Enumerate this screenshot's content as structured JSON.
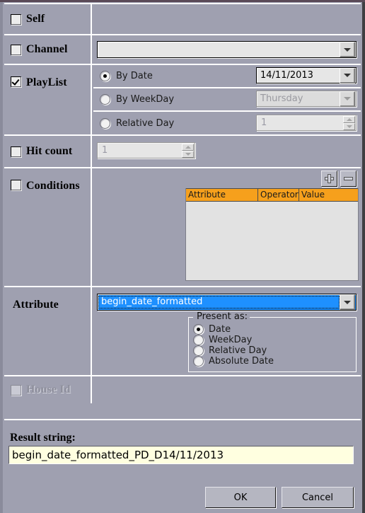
{
  "window": {
    "bg_color": "#9fa0b0",
    "accent_orange": "#f6a01c",
    "select_blue": "#1e90ff",
    "result_bg": "#ffffe0"
  },
  "rows": {
    "self": {
      "label": "Self",
      "checked": false,
      "enabled": true
    },
    "channel": {
      "label": "Channel",
      "checked": false,
      "enabled": true,
      "combo_value": "",
      "combo_placeholder": ""
    },
    "playlist": {
      "label": "PlayList",
      "checked": true,
      "enabled": true,
      "options": [
        {
          "label": "By Date",
          "selected": true
        },
        {
          "label": "By WeekDay",
          "selected": false
        },
        {
          "label": "Relative Day",
          "selected": false
        }
      ],
      "date_value": "14/11/2013",
      "weekday_value": "Thursday",
      "relative_day_value": "1"
    },
    "hit_count": {
      "label": "Hit count",
      "checked": false,
      "enabled": true,
      "value": "1"
    },
    "conditions": {
      "label": "Conditions",
      "checked": false,
      "enabled": true,
      "add_button": "+",
      "remove_button": "-",
      "columns": [
        "Attribute",
        "Operator",
        "Value"
      ],
      "rows": []
    },
    "attribute": {
      "label": "Attribute",
      "combo_value": "begin_date_formatted",
      "present_as": {
        "title": "Present as:",
        "options": [
          {
            "label": "Date",
            "selected": true
          },
          {
            "label": "WeekDay",
            "selected": false
          },
          {
            "label": "Relative Day",
            "selected": false
          },
          {
            "label": "Absolute Date",
            "selected": false
          }
        ]
      }
    },
    "house_id": {
      "label": "House Id",
      "checked": false,
      "enabled": false
    }
  },
  "result": {
    "label": "Result string:",
    "value": "begin_date_formatted_PD_D14/11/2013"
  },
  "footer": {
    "ok_label": "OK",
    "cancel_label": "Cancel"
  }
}
